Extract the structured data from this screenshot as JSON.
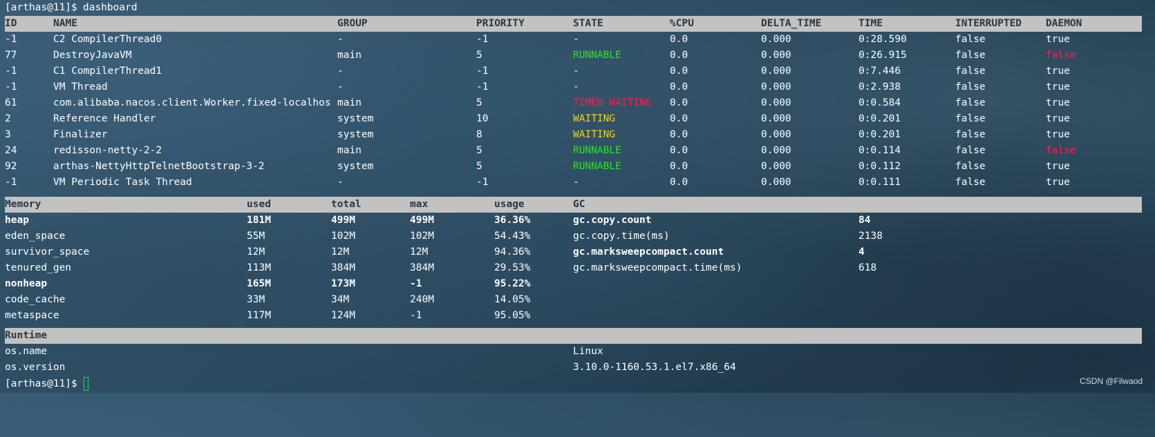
{
  "prompt_user": "[arthas@11]$",
  "command": "dashboard",
  "threads": {
    "headers": [
      "ID",
      "NAME",
      "GROUP",
      "PRIORITY",
      "STATE",
      "%CPU",
      "DELTA_TIME",
      "TIME",
      "INTERRUPTED",
      "DAEMON"
    ],
    "rows": [
      {
        "id": "-1",
        "name": "C2 CompilerThread0",
        "group": "-",
        "priority": "-1",
        "state": "-",
        "cpu": "0.0",
        "delta": "0.000",
        "time": "0:28.590",
        "interrupted": "false",
        "daemon": "true"
      },
      {
        "id": "77",
        "name": "DestroyJavaVM",
        "group": "main",
        "priority": "5",
        "state": "RUNNABLE",
        "cpu": "0.0",
        "delta": "0.000",
        "time": "0:26.915",
        "interrupted": "false",
        "daemon": "false"
      },
      {
        "id": "-1",
        "name": "C1 CompilerThread1",
        "group": "-",
        "priority": "-1",
        "state": "-",
        "cpu": "0.0",
        "delta": "0.000",
        "time": "0:7.446",
        "interrupted": "false",
        "daemon": "true"
      },
      {
        "id": "-1",
        "name": "VM Thread",
        "group": "-",
        "priority": "-1",
        "state": "-",
        "cpu": "0.0",
        "delta": "0.000",
        "time": "0:2.938",
        "interrupted": "false",
        "daemon": "true"
      },
      {
        "id": "61",
        "name": "com.alibaba.nacos.client.Worker.fixed-localhos",
        "group": "main",
        "priority": "5",
        "state": "TIMED_WAITING",
        "cpu": "0.0",
        "delta": "0.000",
        "time": "0:0.584",
        "interrupted": "false",
        "daemon": "true"
      },
      {
        "id": "2",
        "name": "Reference Handler",
        "group": "system",
        "priority": "10",
        "state": "WAITING",
        "cpu": "0.0",
        "delta": "0.000",
        "time": "0:0.201",
        "interrupted": "false",
        "daemon": "true"
      },
      {
        "id": "3",
        "name": "Finalizer",
        "group": "system",
        "priority": "8",
        "state": "WAITING",
        "cpu": "0.0",
        "delta": "0.000",
        "time": "0:0.201",
        "interrupted": "false",
        "daemon": "true"
      },
      {
        "id": "24",
        "name": "redisson-netty-2-2",
        "group": "main",
        "priority": "5",
        "state": "RUNNABLE",
        "cpu": "0.0",
        "delta": "0.000",
        "time": "0:0.114",
        "interrupted": "false",
        "daemon": "false"
      },
      {
        "id": "92",
        "name": "arthas-NettyHttpTelnetBootstrap-3-2",
        "group": "system",
        "priority": "5",
        "state": "RUNNABLE",
        "cpu": "0.0",
        "delta": "0.000",
        "time": "0:0.112",
        "interrupted": "false",
        "daemon": "true"
      },
      {
        "id": "-1",
        "name": "VM Periodic Task Thread",
        "group": "-",
        "priority": "-1",
        "state": "-",
        "cpu": "0.0",
        "delta": "0.000",
        "time": "0:0.111",
        "interrupted": "false",
        "daemon": "true"
      }
    ]
  },
  "memory": {
    "headers": [
      "Memory",
      "used",
      "total",
      "max",
      "usage",
      "GC"
    ],
    "rows": [
      {
        "name": "heap",
        "used": "181M",
        "total": "499M",
        "max": "499M",
        "usage": "36.36%",
        "gc_key": "gc.copy.count",
        "gc_val": "84",
        "bold": true,
        "gc_bold": true
      },
      {
        "name": "eden_space",
        "used": "55M",
        "total": "102M",
        "max": "102M",
        "usage": "54.43%",
        "gc_key": "gc.copy.time(ms)",
        "gc_val": "2138",
        "bold": false,
        "gc_bold": false
      },
      {
        "name": "survivor_space",
        "used": "12M",
        "total": "12M",
        "max": "12M",
        "usage": "94.36%",
        "gc_key": "gc.marksweepcompact.count",
        "gc_val": "4",
        "bold": false,
        "gc_bold": true
      },
      {
        "name": "tenured_gen",
        "used": "113M",
        "total": "384M",
        "max": "384M",
        "usage": "29.53%",
        "gc_key": "gc.marksweepcompact.time(ms)",
        "gc_val": "618",
        "bold": false,
        "gc_bold": false
      },
      {
        "name": "nonheap",
        "used": "165M",
        "total": "173M",
        "max": "-1",
        "usage": "95.22%",
        "gc_key": "",
        "gc_val": "",
        "bold": true,
        "gc_bold": false
      },
      {
        "name": "code_cache",
        "used": "33M",
        "total": "34M",
        "max": "240M",
        "usage": "14.05%",
        "gc_key": "",
        "gc_val": "",
        "bold": false,
        "gc_bold": false
      },
      {
        "name": "metaspace",
        "used": "117M",
        "total": "124M",
        "max": "-1",
        "usage": "95.05%",
        "gc_key": "",
        "gc_val": "",
        "bold": false,
        "gc_bold": false
      }
    ]
  },
  "runtime": {
    "header": "Runtime",
    "rows": [
      {
        "key": "os.name",
        "value": "Linux"
      },
      {
        "key": "os.version",
        "value": "3.10.0-1160.53.1.el7.x86_64"
      }
    ]
  },
  "watermark": "CSDN @Filwaod",
  "colors": {
    "runnable": "#2ee02e",
    "waiting": "#f2d21b",
    "timed_waiting": "#ff1e50",
    "daemon_false": "#ff1e50",
    "header_band": "#c2c2c2",
    "cursor": "#1fd66a"
  }
}
